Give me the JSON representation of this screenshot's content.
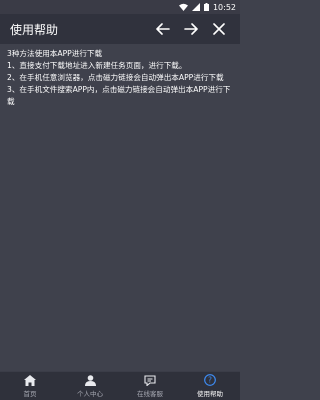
{
  "status_bar": {
    "time": "10:52"
  },
  "header": {
    "title": "使用帮助"
  },
  "content": {
    "lines": [
      "3种方法使用本APP进行下载",
      "1、直接支付下载地址进入新建任务页面，进行下载。",
      "2、在手机任意浏览器，点击磁力链接会自动弹出本APP进行下载",
      "3、在手机文件搜索APP内，点击磁力链接会自动弹出本APP进行下载"
    ]
  },
  "tabbar": {
    "items": [
      {
        "label": "首页",
        "icon": "home-icon"
      },
      {
        "label": "个人中心",
        "icon": "user-icon"
      },
      {
        "label": "在线客服",
        "icon": "chat-icon"
      },
      {
        "label": "使用帮助",
        "icon": "help-icon",
        "active": true
      }
    ]
  },
  "colors": {
    "background": "#3f414c",
    "app_bar": "#30323d",
    "tabbar": "#2f313b",
    "active_icon": "#3d8bf2"
  }
}
